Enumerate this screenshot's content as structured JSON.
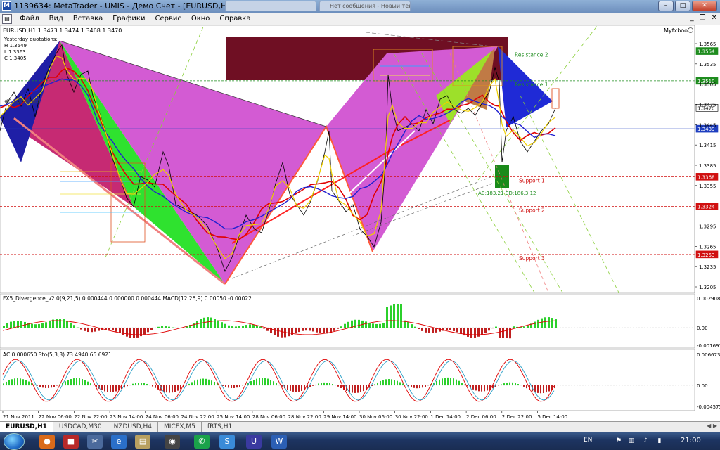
{
  "window": {
    "title": "1139634: MetaTrader - UMIS - Демо Счет - [EURUSD,H1]",
    "browser_tabs": [
      "",
      "Нет сообщения - Новый текст..."
    ]
  },
  "menu": {
    "items": [
      "Файл",
      "Вид",
      "Вставка",
      "Графики",
      "Сервис",
      "Окно",
      "Справка"
    ]
  },
  "chart": {
    "symbol_line": "EURUSD,H1  1.3473 1.3474 1.3468 1.3470",
    "top_right_label": "Myfxbook",
    "yesterday": [
      "Yesterday quotations:",
      "H 1.3549",
      "L 1.3363",
      "C 1.3405"
    ],
    "order_label": "#8 1.2945 sell",
    "levels": [
      {
        "label": "Resistance 2",
        "price": "1.3554",
        "price_val": 1.3554,
        "color": "#1e8c1e",
        "box": true
      },
      {
        "label": "Resistance 1",
        "price": "1.3510",
        "price_val": 1.351,
        "color": "#1e8c1e",
        "box": true
      },
      {
        "label": "",
        "price": "1.3470",
        "price_val": 1.347,
        "color": "#c0c0c0",
        "box": true
      },
      {
        "label": "",
        "price": "1.3439",
        "price_val": 1.3439,
        "color": "#1f3fc0",
        "box": true
      },
      {
        "label": "Support 1",
        "price": "1.3368",
        "price_val": 1.3368,
        "color": "#d01010",
        "box": true
      },
      {
        "label": "Support 2",
        "price": "1.3324",
        "price_val": 1.3324,
        "color": "#d01010",
        "box": true
      },
      {
        "label": "Support 3",
        "price": "1.3253",
        "price_val": 1.3253,
        "color": "#d01010",
        "box": true
      }
    ],
    "axis_prices": [
      "1.3565",
      "1.3535",
      "1.3505",
      "1.3475",
      "1.3445",
      "1.3415",
      "1.3385",
      "1.3355",
      "1.3295",
      "1.3265",
      "1.3235",
      "1.3205"
    ],
    "pattern_label": "AB:183.21 CD:186.3  12",
    "indicator1": {
      "label": "FX5_Divergence_v2.0(9,21,5) 0.000444 0.000000 0.000444  MACD(12,26,9) 0.00050 -0.00022",
      "axis": [
        "0.002908",
        "0.00",
        "-0.001691"
      ]
    },
    "indicator2": {
      "label": "AC 0.000650  Sto(5,3,3) 73.4940 65.6921",
      "axis": [
        "0.006673",
        "0.00",
        "-0.004575"
      ]
    },
    "time_axis": [
      "21 Nov 2011",
      "22 Nov 06:00",
      "22 Nov 22:00",
      "23 Nov 14:00",
      "24 Nov 06:00",
      "24 Nov 22:00",
      "25 Nov 14:00",
      "28 Nov 06:00",
      "28 Nov 22:00",
      "29 Nov 14:00",
      "30 Nov 06:00",
      "30 Nov 22:00",
      "1 Dec 14:00",
      "2 Dec 06:00",
      "2 Dec 22:00",
      "5 Dec 14:00"
    ]
  },
  "tabs": {
    "items": [
      "EURUSD,H1",
      "USDCAD,M30",
      "NZDUSD,H4",
      "MICEX,M5",
      "fRTS,H1"
    ],
    "active": 0
  },
  "taskbar": {
    "lang": "EN",
    "clock": "21:00"
  }
}
